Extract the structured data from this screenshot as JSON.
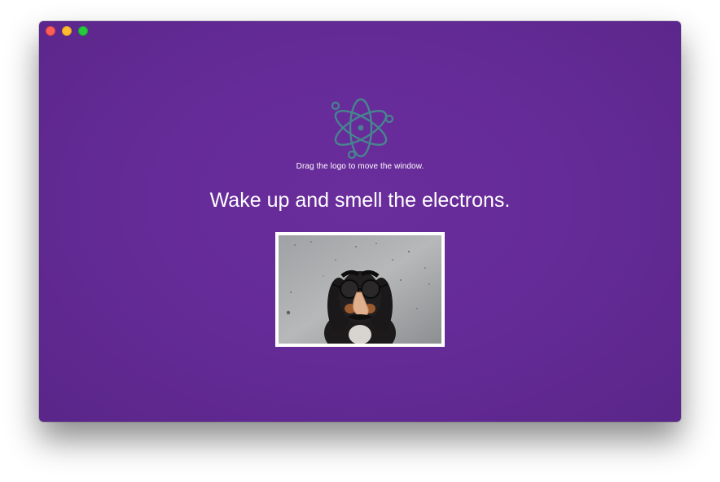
{
  "window": {
    "background_color": "#652b98",
    "controls": [
      "close",
      "minimize",
      "zoom"
    ]
  },
  "logo": {
    "icon": "electron-logo-icon",
    "color": "#47848f"
  },
  "hint_text": "Drag the logo to move the window.",
  "headline": "Wake up and smell the electrons.",
  "photo": {
    "subject": "dog-with-groucho-glasses"
  }
}
